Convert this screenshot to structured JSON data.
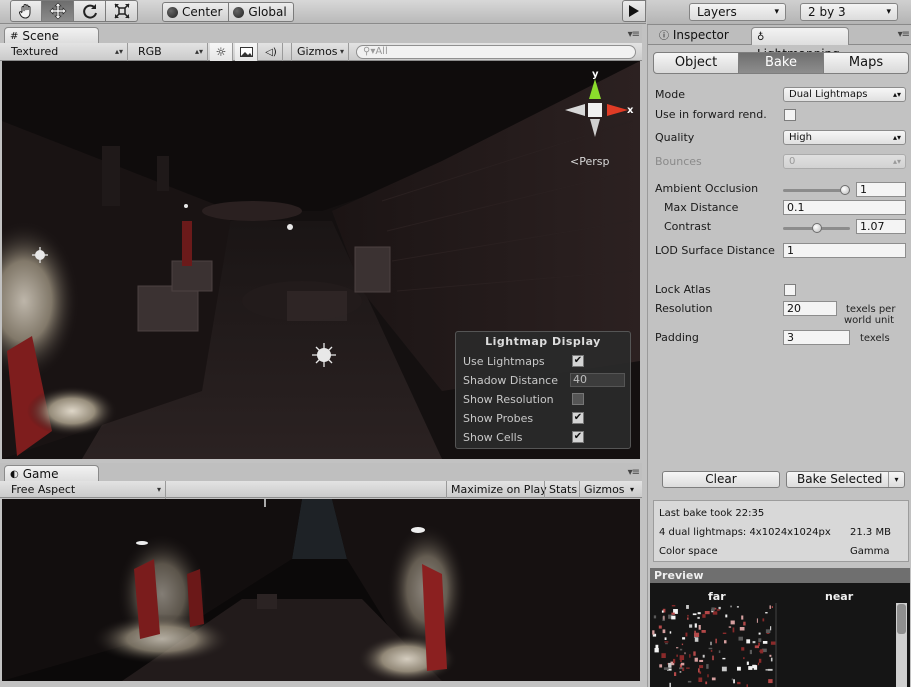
{
  "toolbar": {
    "tools": [
      "hand-icon",
      "move-icon",
      "rotate-icon",
      "scale-icon"
    ],
    "pivot_mode": "Center",
    "pivot_rotation": "Global"
  },
  "top_right": {
    "layers": "Layers",
    "layout": "2 by 3"
  },
  "scene": {
    "tab_label": "Scene",
    "render_mode": "Textured",
    "color_mode": "RGB",
    "gizmos": "Gizmos",
    "search_placeholder": "All",
    "persp_label": "Persp",
    "axis_x": "x",
    "axis_y": "y"
  },
  "lightmap_display": {
    "title": "Lightmap Display",
    "use_lightmaps": "Use Lightmaps",
    "use_lightmaps_checked": true,
    "shadow_distance_label": "Shadow Distance",
    "shadow_distance_value": "40",
    "show_resolution": "Show Resolution",
    "show_resolution_checked": false,
    "show_probes": "Show Probes",
    "show_probes_checked": true,
    "show_cells": "Show Cells",
    "show_cells_checked": true
  },
  "game": {
    "tab_label": "Game",
    "aspect": "Free Aspect",
    "maximize": "Maximize on Play",
    "stats": "Stats",
    "gizmos": "Gizmos"
  },
  "right_panel": {
    "tabs": [
      "Inspector",
      "Lightmapping"
    ],
    "segments": [
      "Object",
      "Bake",
      "Maps"
    ],
    "active_segment": "Bake",
    "mode_label": "Mode",
    "mode_value": "Dual Lightmaps",
    "forward_label": "Use in forward rend.",
    "quality_label": "Quality",
    "quality_value": "High",
    "bounces_label": "Bounces",
    "bounces_value": "0",
    "ao_label": "Ambient Occlusion",
    "ao_value": "1",
    "ao_fraction": 1.0,
    "max_distance_label": "Max Distance",
    "max_distance_value": "0.1",
    "contrast_label": "Contrast",
    "contrast_value": "1.07",
    "contrast_fraction": 0.5,
    "lod_label": "LOD Surface Distance",
    "lod_value": "1",
    "lock_atlas_label": "Lock Atlas",
    "resolution_label": "Resolution",
    "resolution_value": "20",
    "resolution_unit_1": "texels per",
    "resolution_unit_2": "world unit",
    "padding_label": "Padding",
    "padding_value": "3",
    "padding_unit": "texels",
    "clear_button": "Clear",
    "bake_button": "Bake Selected",
    "last_bake": "Last bake took 22:35",
    "lightmap_info": "4 dual lightmaps: 4x1024x1024px",
    "lightmap_size": "21.3 MB",
    "color_space_label": "Color space",
    "color_space_value": "Gamma",
    "preview_header": "Preview",
    "preview_far": "far",
    "preview_near": "near"
  }
}
